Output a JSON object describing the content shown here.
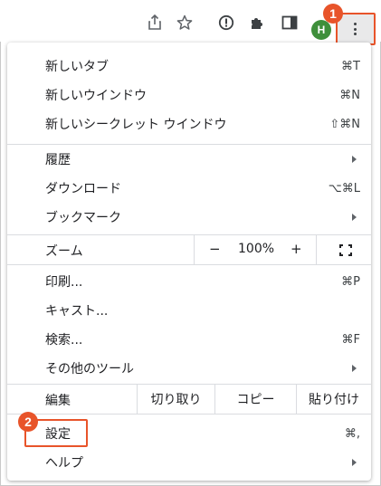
{
  "toolbar": {
    "icons": [
      "share-icon",
      "star-icon",
      "password-icon",
      "extensions-icon",
      "sidepanel-icon"
    ],
    "avatar_letter": "H",
    "menu_icon": "kebab-menu-icon"
  },
  "badges": {
    "one": "1",
    "two": "2"
  },
  "menu": {
    "new_tab": {
      "label": "新しいタブ",
      "shortcut": "⌘T"
    },
    "new_window": {
      "label": "新しいウインドウ",
      "shortcut": "⌘N"
    },
    "new_incognito": {
      "label": "新しいシークレット ウインドウ",
      "shortcut": "⇧⌘N"
    },
    "history": {
      "label": "履歴"
    },
    "downloads": {
      "label": "ダウンロード",
      "shortcut": "⌥⌘L"
    },
    "bookmarks": {
      "label": "ブックマーク"
    },
    "zoom": {
      "label": "ズーム",
      "minus": "−",
      "value": "100%",
      "plus": "+"
    },
    "print": {
      "label": "印刷...",
      "shortcut": "⌘P"
    },
    "cast": {
      "label": "キャスト..."
    },
    "find": {
      "label": "検索...",
      "shortcut": "⌘F"
    },
    "more_tools": {
      "label": "その他のツール"
    },
    "edit": {
      "label": "編集",
      "cut": "切り取り",
      "copy": "コピー",
      "paste": "貼り付け"
    },
    "settings": {
      "label": "設定",
      "shortcut": "⌘,"
    },
    "help": {
      "label": "ヘルプ"
    }
  },
  "colors": {
    "highlight": "#e8542a",
    "avatar": "#3f8f3b"
  }
}
